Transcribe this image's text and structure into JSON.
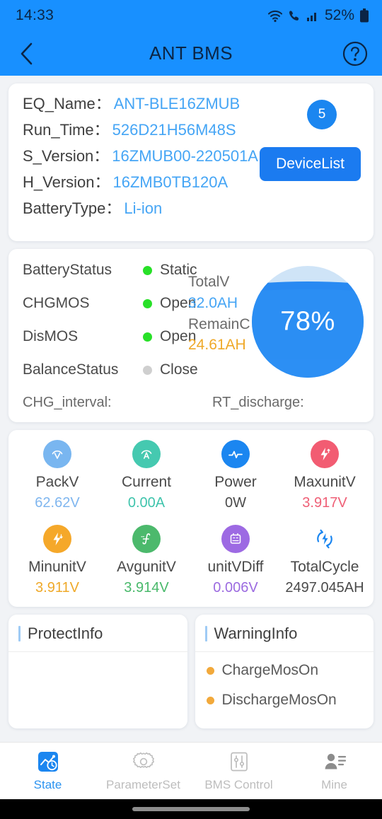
{
  "status_bar": {
    "time": "14:33",
    "battery_percent": "52%",
    "icons": [
      "wifi-icon",
      "phone-call-icon",
      "cellular-signal-icon",
      "battery-icon"
    ]
  },
  "app_bar": {
    "title": "ANT BMS",
    "back_icon": "chevron-left-icon",
    "help_icon": "question-mark-circle-icon"
  },
  "device_info": {
    "rows": [
      {
        "label": "EQ_Name：",
        "value": "ANT-BLE16ZMUB"
      },
      {
        "label": "Run_Time：",
        "value": "526D21H56M48S"
      },
      {
        "label": "S_Version：",
        "value": "16ZMUB00-220501A"
      },
      {
        "label": "H_Version：",
        "value": "16ZMB0TB120A"
      },
      {
        "label": "BatteryType：",
        "value": "Li-ion"
      }
    ],
    "badge": "5",
    "device_list_button": "DeviceList"
  },
  "battery_status": {
    "lines": [
      {
        "name": "BatteryStatus",
        "state": "Static",
        "indicator": "green"
      },
      {
        "name": "CHGMOS",
        "state": "Open",
        "indicator": "green"
      },
      {
        "name": "DisMOS",
        "state": "Open",
        "indicator": "green"
      },
      {
        "name": "BalanceStatus",
        "state": "Close",
        "indicator": "gray"
      }
    ],
    "capacity": {
      "total_label": "TotalV",
      "total_value": "32.0AH",
      "remain_label": "RemainC",
      "remain_value": "24.61AH"
    },
    "gauge": {
      "percent_text": "78%",
      "fill_percent": 78
    },
    "chg_interval_label": "CHG_interval:",
    "chg_interval_value": "",
    "rt_discharge_label": "RT_discharge:",
    "rt_discharge_value": ""
  },
  "metrics": [
    {
      "name": "PackV",
      "value": "62.62V",
      "value_color": "#7fb6ef",
      "icon": "voltage-icon",
      "icon_bg": "#79b6f0"
    },
    {
      "name": "Current",
      "value": "0.00A",
      "value_color": "#3fc4ac",
      "icon": "ampere-icon",
      "icon_bg": "#45c9b0"
    },
    {
      "name": "Power",
      "value": "0W",
      "value_color": "#4a4a4a",
      "icon": "power-pulse-icon",
      "icon_bg": "#1b86f0"
    },
    {
      "name": "MaxunitV",
      "value": "3.917V",
      "value_color": "#ef5f76",
      "icon": "bolt-up-icon",
      "icon_bg": "#f25c72"
    },
    {
      "name": "MinunitV",
      "value": "3.911V",
      "value_color": "#efa929",
      "icon": "bolt-down-icon",
      "icon_bg": "#f5a82a"
    },
    {
      "name": "AvgunitV",
      "value": "3.914V",
      "value_color": "#49b96b",
      "icon": "average-curve-icon",
      "icon_bg": "#4cb96c"
    },
    {
      "name": "unitVDiff",
      "value": "0.006V",
      "value_color": "#9b6ae0",
      "icon": "battery-meter-icon",
      "icon_bg": "#9d6ae3"
    },
    {
      "name": "TotalCycle",
      "value": "2497.045AH",
      "value_color": "#4a4a4a",
      "icon": "cycle-bolt-icon",
      "icon_bg": "none"
    }
  ],
  "protect_info": {
    "title": "ProtectInfo",
    "items": []
  },
  "warning_info": {
    "title": "WarningInfo",
    "items": [
      "ChargeMosOn",
      "DischargeMosOn"
    ]
  },
  "tabs": [
    {
      "label": "State",
      "icon": "chart-clock-icon",
      "active": true
    },
    {
      "label": "ParameterSet",
      "icon": "gear-icon",
      "active": false
    },
    {
      "label": "BMS Control",
      "icon": "sliders-icon",
      "active": false
    },
    {
      "label": "Mine",
      "icon": "person-list-icon",
      "active": false
    }
  ],
  "colors": {
    "brand_blue": "#1890ff",
    "value_blue": "#45a5f5",
    "accent_orange": "#efa929",
    "status_green": "#28e028",
    "page_bg": "#f1f3f6"
  }
}
